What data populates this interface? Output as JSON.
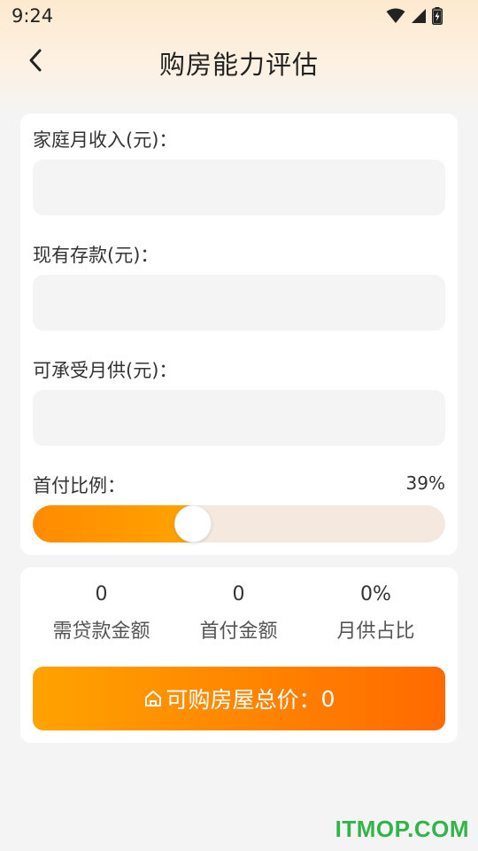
{
  "status_bar": {
    "time": "9:24",
    "icons": [
      "wifi-icon",
      "signal-icon",
      "battery-charging-icon"
    ]
  },
  "header": {
    "title": "购房能力评估",
    "back_icon": "chevron-left-icon"
  },
  "form": {
    "income_label": "家庭月收入(元)：",
    "income_value": "",
    "savings_label": "现有存款(元)：",
    "savings_value": "",
    "monthly_payment_label": "可承受月供(元)：",
    "monthly_payment_value": "",
    "down_payment_ratio_label": "首付比例：",
    "down_payment_ratio_text": "39%",
    "down_payment_ratio": 0.39
  },
  "results": {
    "stats": [
      {
        "value": "0",
        "label": "需贷款金额"
      },
      {
        "value": "0",
        "label": "首付金额"
      },
      {
        "value": "0%",
        "label": "月供占比"
      }
    ],
    "total_button_label": "可购房屋总价：",
    "total_value": "0",
    "total_icon": "house-icon"
  },
  "watermark": "ITMOP.COM",
  "colors": {
    "accent": "#ff8b00",
    "accent_end": "#ff6a00",
    "track": "#f4e8df",
    "watermark": "#33b44a"
  }
}
